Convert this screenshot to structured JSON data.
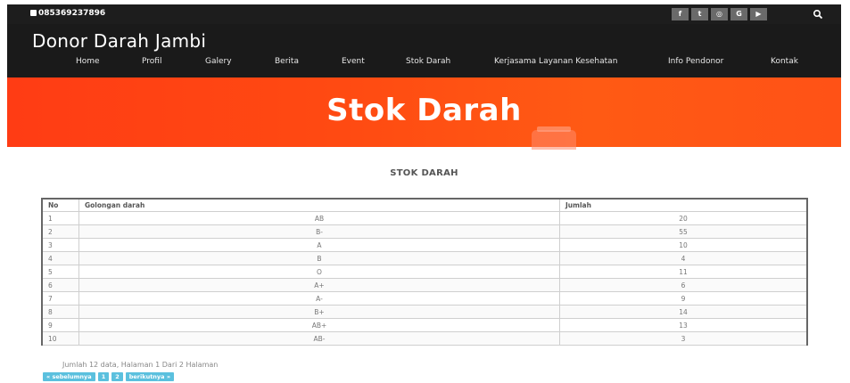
{
  "topbar": {
    "phone": "085369237896",
    "social": [
      {
        "icon": "facebook-icon",
        "glyph": "f"
      },
      {
        "icon": "twitter-icon",
        "glyph": "t"
      },
      {
        "icon": "instagram-icon",
        "glyph": "◎"
      },
      {
        "icon": "google-plus-icon",
        "glyph": "G"
      },
      {
        "icon": "youtube-icon",
        "glyph": "▶"
      }
    ]
  },
  "header": {
    "brand": "Donor Darah Jambi",
    "nav": [
      "Home",
      "Profil",
      "Galery",
      "Berita",
      "Event",
      "Stok Darah",
      "Kerjasama Layanan Kesehatan",
      "Info Pendonor",
      "Kontak"
    ]
  },
  "banner": {
    "title": "Stok Darah"
  },
  "main": {
    "section_title": "STOK DARAH",
    "columns": [
      "No",
      "Golongan darah",
      "Jumlah"
    ],
    "rows": [
      [
        "1",
        "AB",
        "20"
      ],
      [
        "2",
        "B-",
        "55"
      ],
      [
        "3",
        "A",
        "10"
      ],
      [
        "4",
        "B",
        "4"
      ],
      [
        "5",
        "O",
        "11"
      ],
      [
        "6",
        "A+",
        "6"
      ],
      [
        "7",
        "A-",
        "9"
      ],
      [
        "8",
        "B+",
        "14"
      ],
      [
        "9",
        "AB+",
        "13"
      ],
      [
        "10",
        "AB-",
        "3"
      ]
    ],
    "page_info": "Jumlah 12 data, Halaman 1 Dari 2 Halaman",
    "pager": [
      "« sebelumnya",
      "1",
      "2",
      "berikutnya »"
    ]
  },
  "colors": {
    "banner": "#ff4a12",
    "header": "#1a1a1a",
    "pager": "#5bc0de"
  }
}
